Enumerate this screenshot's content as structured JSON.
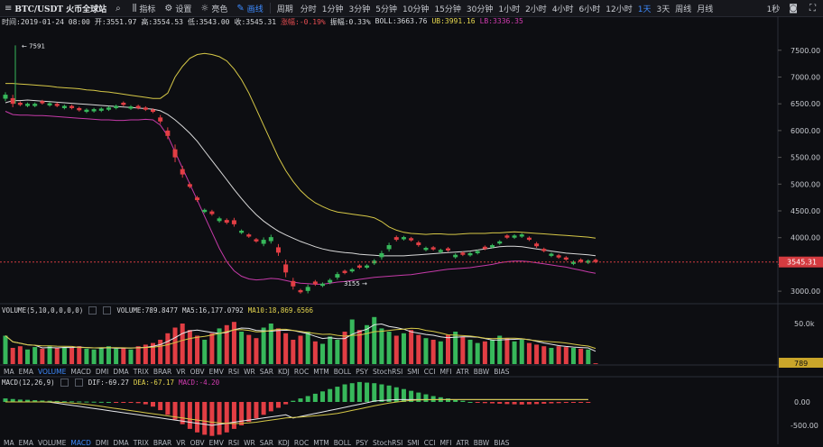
{
  "toolbar": {
    "title": "BTC/USDT 火币全球站",
    "search_icon": "search-icon",
    "indicators_label": "指标",
    "settings_label": "设置",
    "theme_label": "亮色",
    "draw_label": "画线",
    "period_label": "周期",
    "periods": [
      "分时",
      "1分钟",
      "3分钟",
      "5分钟",
      "10分钟",
      "15分钟",
      "30分钟",
      "1小时",
      "2小时",
      "4小时",
      "6小时",
      "12小时",
      "1天",
      "3天",
      "周线",
      "月线"
    ],
    "active_period": "1天",
    "refresh_label": "1秒"
  },
  "info": {
    "time": "时间:2019-01-24 08:00",
    "open": "开:3551.97",
    "high": "高:3554.53",
    "low": "低:3543.00",
    "close": "收:3545.31",
    "change": "涨幅:-0.19%",
    "amplitude": "振幅:0.33%",
    "boll": "BOLL:3663.76",
    "ub": "UB:3991.16",
    "lb": "LB:3336.35"
  },
  "price_axis": {
    "ticks": [
      "7500.00",
      "7000.00",
      "6500.00",
      "6000.00",
      "5500.00",
      "5000.00",
      "4500.00",
      "4000.00",
      "3500.00",
      "3000.00"
    ],
    "current": "3545.31",
    "high_marker": "7591",
    "low_marker": "3155"
  },
  "volume_panel": {
    "label": "VOLUME(5,10,0,0,0,0)",
    "volume": "VOLUME:789.8477",
    "ma5": "MA5:16,177.0792",
    "ma10": "MA10:18,869.6566",
    "axis_tick": "50.0k",
    "current": "789"
  },
  "indicator_tabs": [
    "MA",
    "EMA",
    "VOLUME",
    "MACD",
    "DMI",
    "DMA",
    "TRIX",
    "BRAR",
    "VR",
    "OBV",
    "EMV",
    "RSI",
    "WR",
    "SAR",
    "KDJ",
    "ROC",
    "MTM",
    "BOLL",
    "PSY",
    "StochRSI",
    "SMI",
    "CCI",
    "MFI",
    "ATR",
    "BBW",
    "BIAS"
  ],
  "active_indicator_tab": "VOLUME",
  "second_indicator_tabs": [
    "MA",
    "EMA",
    "VOLUME",
    "MACD",
    "DMI",
    "DMA",
    "TRIX",
    "BRAR",
    "VR",
    "OBV",
    "EMV",
    "RSI",
    "WR",
    "SAR",
    "KDJ",
    "ROC",
    "MTM",
    "BOLL",
    "PSY",
    "StochRSI",
    "SMI",
    "CCI",
    "MFI",
    "ATR",
    "BBW",
    "BIAS"
  ],
  "active_second_tab": "MACD",
  "macd_panel": {
    "label": "MACD(12,26,9)",
    "dif": "DIF:-69.27",
    "dea": "DEA:-67.17",
    "macd": "MACD:-4.20",
    "axis_tick_top": "0.00",
    "axis_tick_bottom": "-500.00"
  },
  "colors": {
    "up": "#37b85b",
    "down": "#e23e44",
    "boll_upper": "#d6c847",
    "boll_mid": "#d9d9d9",
    "boll_lower": "#c53aa8",
    "accent": "#3d8bff",
    "current_price": "#d43b40"
  },
  "chart_data": [
    {
      "type": "line",
      "title": "BTC/USDT 1天",
      "series": [
        {
          "name": "UB",
          "values": [
            6880,
            6880,
            6870,
            6860,
            6850,
            6840,
            6830,
            6810,
            6800,
            6790,
            6780,
            6760,
            6750,
            6730,
            6720,
            6700,
            6680,
            6660,
            6640,
            6620,
            6600,
            6600,
            6700,
            7000,
            7200,
            7350,
            7420,
            7440,
            7420,
            7380,
            7300,
            7150,
            6950,
            6700,
            6400,
            6100,
            5800,
            5500,
            5250,
            5050,
            4880,
            4750,
            4650,
            4580,
            4520,
            4480,
            4460,
            4440,
            4420,
            4400,
            4370,
            4300,
            4200,
            4140,
            4100,
            4080,
            4070,
            4060,
            4070,
            4070,
            4060,
            4060,
            4070,
            4080,
            4080,
            4080,
            4090,
            4090,
            4100,
            4110,
            4100,
            4090,
            4080,
            4070,
            4060,
            4050,
            4040,
            4030,
            4020,
            4010,
            3991
          ]
        },
        {
          "name": "BOLL",
          "values": [
            6520,
            6560,
            6560,
            6570,
            6560,
            6550,
            6540,
            6530,
            6520,
            6510,
            6500,
            6490,
            6480,
            6470,
            6460,
            6450,
            6440,
            6430,
            6420,
            6410,
            6400,
            6370,
            6300,
            6200,
            6080,
            5950,
            5800,
            5620,
            5440,
            5260,
            5080,
            4900,
            4730,
            4570,
            4430,
            4310,
            4210,
            4120,
            4050,
            3990,
            3930,
            3880,
            3830,
            3790,
            3760,
            3740,
            3720,
            3710,
            3690,
            3680,
            3670,
            3660,
            3660,
            3660,
            3660,
            3670,
            3680,
            3690,
            3700,
            3710,
            3720,
            3730,
            3740,
            3750,
            3770,
            3790,
            3810,
            3830,
            3840,
            3840,
            3830,
            3810,
            3790,
            3770,
            3750,
            3730,
            3710,
            3700,
            3690,
            3680,
            3664
          ]
        },
        {
          "name": "LB",
          "values": [
            6360,
            6300,
            6290,
            6290,
            6280,
            6280,
            6270,
            6260,
            6250,
            6240,
            6230,
            6220,
            6210,
            6200,
            6200,
            6190,
            6190,
            6200,
            6200,
            6210,
            6200,
            6100,
            5900,
            5600,
            5300,
            5000,
            4700,
            4400,
            4100,
            3800,
            3550,
            3380,
            3280,
            3230,
            3210,
            3220,
            3240,
            3230,
            3200,
            3170,
            3150,
            3140,
            3130,
            3130,
            3150,
            3170,
            3180,
            3200,
            3220,
            3240,
            3260,
            3270,
            3280,
            3290,
            3300,
            3310,
            3330,
            3350,
            3370,
            3390,
            3410,
            3420,
            3430,
            3440,
            3460,
            3480,
            3500,
            3530,
            3550,
            3560,
            3560,
            3550,
            3530,
            3510,
            3490,
            3470,
            3450,
            3420,
            3390,
            3360,
            3336
          ]
        }
      ],
      "ylim": [
        2800,
        7900
      ],
      "current_price": 3545.31,
      "annotations": [
        "7591",
        "3155"
      ]
    },
    {
      "type": "bar",
      "title": "VOLUME(5,10,0,0,0,0)",
      "values": [
        35,
        20,
        22,
        18,
        21,
        19,
        22,
        20,
        21,
        20,
        22,
        19,
        18,
        20,
        22,
        19,
        20,
        18,
        22,
        24,
        26,
        30,
        38,
        45,
        50,
        42,
        35,
        30,
        38,
        44,
        48,
        52,
        40,
        36,
        32,
        45,
        50,
        44,
        38,
        30,
        35,
        40,
        28,
        25,
        34,
        30,
        40,
        55,
        42,
        48,
        58,
        44,
        40,
        35,
        38,
        42,
        36,
        32,
        30,
        28,
        36,
        40,
        34,
        30,
        26,
        28,
        30,
        35,
        32,
        28,
        30,
        26,
        24,
        22,
        20,
        22,
        21,
        20,
        19,
        18,
        1
      ]
    },
    {
      "type": "bar",
      "title": "MACD(12,26,9)",
      "values": [
        30,
        25,
        20,
        18,
        15,
        12,
        10,
        8,
        6,
        5,
        4,
        3,
        2,
        1,
        0,
        -2,
        -4,
        -6,
        -10,
        -20,
        -40,
        -70,
        -110,
        -150,
        -190,
        -230,
        -260,
        -280,
        -290,
        -280,
        -260,
        -230,
        -200,
        -170,
        -140,
        -110,
        -80,
        -50,
        -20,
        10,
        30,
        50,
        70,
        90,
        110,
        130,
        150,
        160,
        170,
        165,
        160,
        150,
        140,
        125,
        110,
        95,
        80,
        65,
        50,
        40,
        30,
        20,
        10,
        0,
        -5,
        -10,
        -12,
        -15,
        -18,
        -20,
        -22,
        -20,
        -18,
        -15,
        -12,
        -10,
        -8,
        -6,
        -5,
        -4
      ],
      "dif": -69.27,
      "dea": -67.17,
      "macd": -4.2
    }
  ]
}
